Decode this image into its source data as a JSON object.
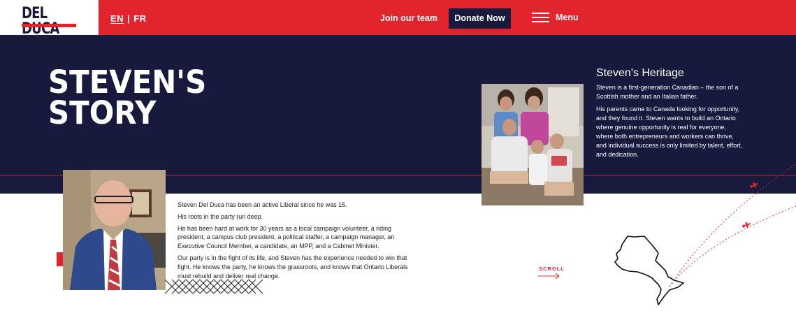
{
  "header": {
    "logo": "DEL DUCA",
    "lang_en": "EN",
    "lang_sep": "|",
    "lang_fr": "FR",
    "join_label": "Join our team",
    "donate_label": "Donate Now",
    "menu_label": "Menu"
  },
  "hero": {
    "title_line1": "STEVEN'S",
    "title_line2": "STORY"
  },
  "heritage": {
    "title": "Steven's Heritage",
    "paragraphs": [
      "Steven is a first-generation Canadian – the son of a Scottish mother and an Italian father.",
      "His parents came to Canada looking for opportunity, and they found it. Steven wants to build an Ontario where genuine opportunity is real for everyone, where both entrepreneurs and workers can thrive, and individual success is only limited by talent, effort, and dedication."
    ]
  },
  "story": {
    "paragraphs": [
      "Steven Del Duca has been an active Liberal since he was 15.",
      "His roots in the party run deep.",
      "He has been hard at work for 30 years as a local campaign volunteer, a riding president, a campus club president, a political staffer, a campaign manager, an Executive Council Member, a candidate, an MPP, and a Cabinet Minister.",
      "Our party is in the fight of its life, and Steven has the experience needed to win that fight. He knows the party, he knows the grassroots, and knows that Ontario Liberals must rebuild and deliver real change."
    ]
  },
  "scroll": {
    "label": "SCROLL"
  },
  "colors": {
    "brand_red": "#e2252d",
    "navy": "#17193d"
  }
}
